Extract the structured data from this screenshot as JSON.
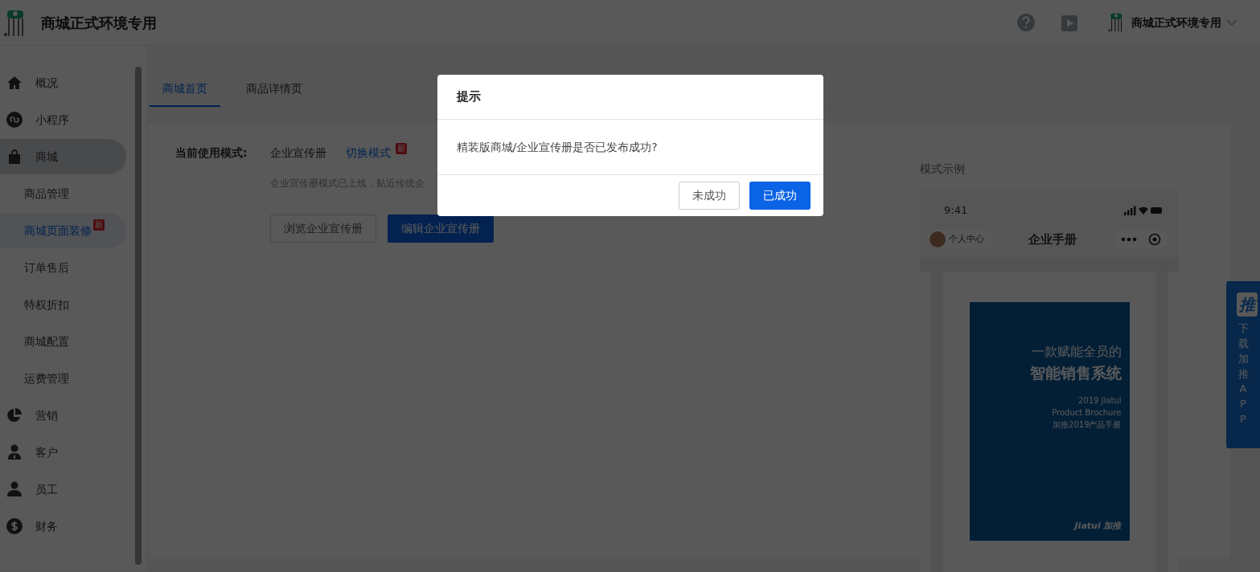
{
  "header": {
    "title": "商城正式环境专用",
    "user_name": "商城正式环境专用"
  },
  "sidebar": {
    "items": [
      {
        "label": "概况",
        "selected": false,
        "expanded": false
      },
      {
        "label": "小程序",
        "selected": false,
        "expanded": false
      },
      {
        "label": "商城",
        "selected": false,
        "expanded": true,
        "children": [
          {
            "label": "商品管理",
            "selected": false
          },
          {
            "label": "商城页面装修",
            "selected": true,
            "badge": "新"
          },
          {
            "label": "订单售后",
            "selected": false
          },
          {
            "label": "特权折扣",
            "selected": false
          },
          {
            "label": "商城配置",
            "selected": false
          },
          {
            "label": "运费管理",
            "selected": false
          }
        ]
      },
      {
        "label": "营销",
        "selected": false,
        "expanded": false
      },
      {
        "label": "客户",
        "selected": false,
        "expanded": false
      },
      {
        "label": "员工",
        "selected": false,
        "expanded": false
      },
      {
        "label": "财务",
        "selected": false,
        "expanded": false
      }
    ]
  },
  "tabs": [
    {
      "label": "商城首页",
      "selected": true
    },
    {
      "label": "商品详情页",
      "selected": false
    }
  ],
  "mode": {
    "label": "当前使用模式:",
    "value": "企业宣传册",
    "switch_link": "切换模式",
    "badge": "新",
    "note": "企业宣传册模式已上线，贴近传统企",
    "buttons": [
      {
        "label": "浏览企业宣传册",
        "kind": "secondary"
      },
      {
        "label": "编辑企业宣传册",
        "kind": "primary"
      }
    ]
  },
  "preview": {
    "title": "模式示例",
    "phone": {
      "time": "9:41",
      "profile": "个人中心",
      "title": "企业手册"
    },
    "cover": {
      "subtitle": "一款赋能全员的",
      "headline": "智能销售系统",
      "lines": [
        "2019 Jiatui",
        "Product Brochure",
        "加推2019产品手册"
      ],
      "brand": "Jiatui 加推"
    }
  },
  "float_tab": {
    "logo": "推",
    "text": "下载加推APP"
  },
  "modal": {
    "title": "提示",
    "message": "精装版商城/企业宣传册是否已发布成功?",
    "buttons": [
      {
        "label": "未成功",
        "kind": "secondary"
      },
      {
        "label": "已成功",
        "kind": "primary"
      }
    ]
  }
}
